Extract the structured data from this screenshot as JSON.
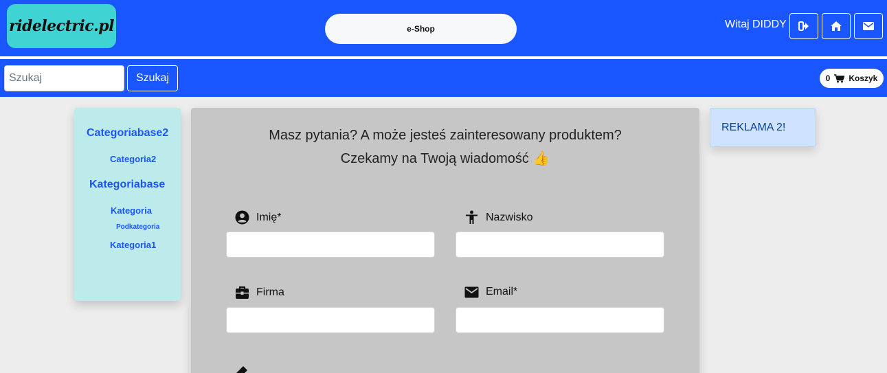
{
  "header": {
    "logo_text": "ridelectric.pl",
    "center_label": "e-Shop",
    "welcome": "Witaj DIDDY",
    "buttons": [
      "logout-icon",
      "home-icon",
      "envelope-icon"
    ]
  },
  "search": {
    "placeholder": "Szukaj",
    "button_label": "Szukaj"
  },
  "cart": {
    "count": "0",
    "label": "Koszyk"
  },
  "sidebar": {
    "items": [
      {
        "label": "Categoriabase2",
        "level": 0
      },
      {
        "label": "Categoria2",
        "level": 1
      },
      {
        "label": "Kategoriabase",
        "level": 0
      },
      {
        "label": "Kategoria",
        "level": 1
      },
      {
        "label": "Podkategoria",
        "level": 2
      },
      {
        "label": "Kategoria1",
        "level": 1
      }
    ]
  },
  "contact": {
    "line1": "Masz pytania? A może jesteś zainteresowany produktem?",
    "line2": "Czekamy na Twoją wiadomość 👍",
    "fields": [
      {
        "label": "Imię*",
        "icon": "user-circle-icon"
      },
      {
        "label": "Nazwisko",
        "icon": "person-icon"
      },
      {
        "label": "Firma",
        "icon": "briefcase-icon"
      },
      {
        "label": "Email*",
        "icon": "envelope-icon"
      }
    ]
  },
  "ad": {
    "label": "REKLAMA 2!"
  },
  "colors": {
    "primary": "#1a56ff",
    "logo_bg": "#3fd3d3",
    "sidebar_bg": "#bdebeb",
    "panel_bg": "#c6c6c6",
    "ad_bg": "#cfe2ff"
  }
}
